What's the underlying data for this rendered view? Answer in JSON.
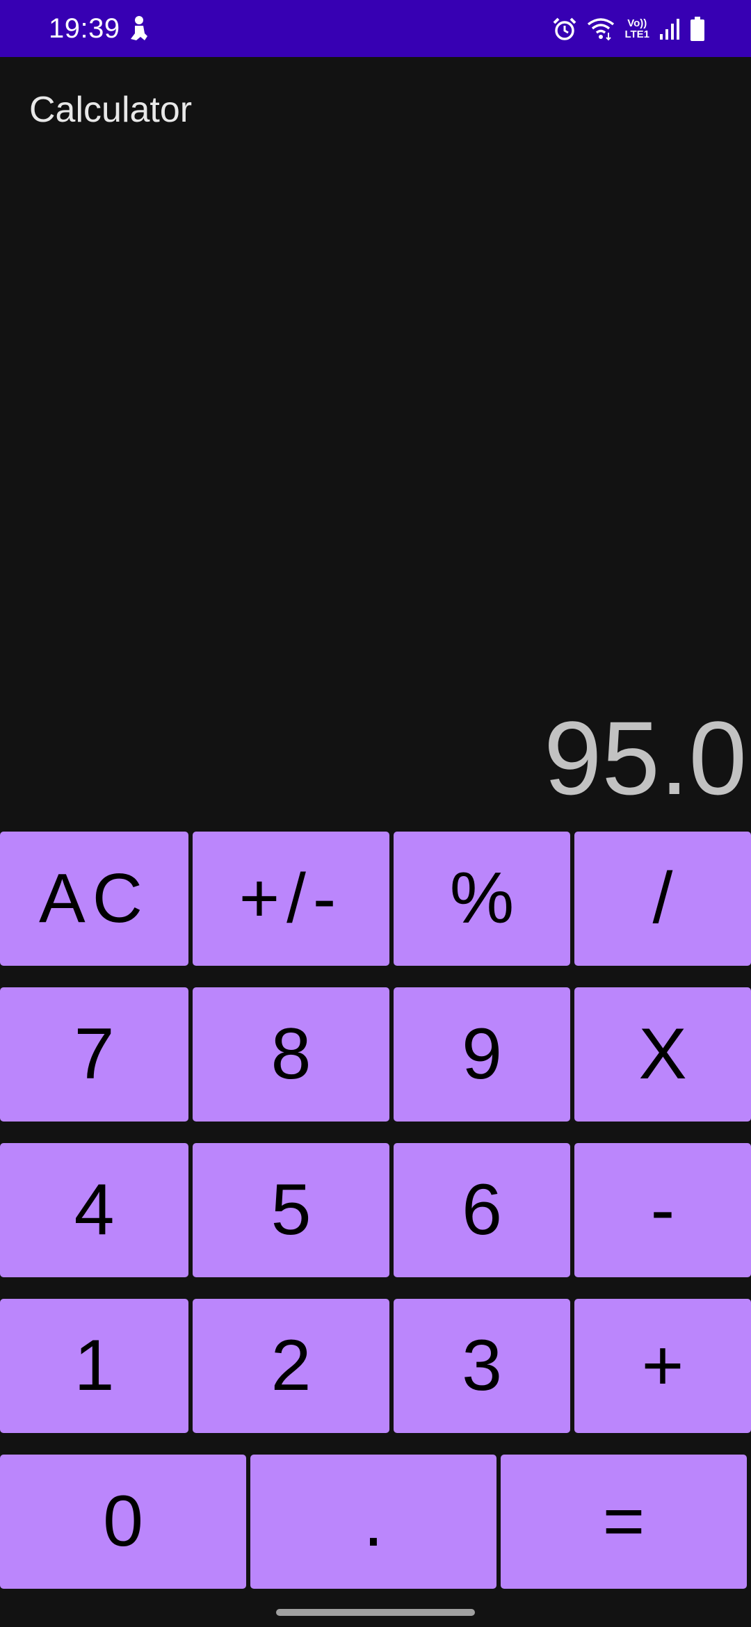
{
  "status_bar": {
    "time": "19:39",
    "volte_top": "Vo))",
    "volte_bottom": "LTE1",
    "icons": [
      "person-icon",
      "alarm-icon",
      "wifi-icon",
      "volte-icon",
      "signal-icon",
      "battery-icon"
    ]
  },
  "app": {
    "title": "Calculator"
  },
  "display": {
    "value": "95.0"
  },
  "keypad": {
    "rows": [
      [
        "AC",
        "+/-",
        "%",
        "/"
      ],
      [
        "7",
        "8",
        "9",
        "X"
      ],
      [
        "4",
        "5",
        "6",
        "-"
      ],
      [
        "1",
        "2",
        "3",
        "+"
      ],
      [
        "0",
        ".",
        "="
      ]
    ]
  },
  "colors": {
    "status_bar": "#3700b3",
    "background": "#121212",
    "key": "#bb86fc",
    "display_text": "#c2c2c2"
  }
}
